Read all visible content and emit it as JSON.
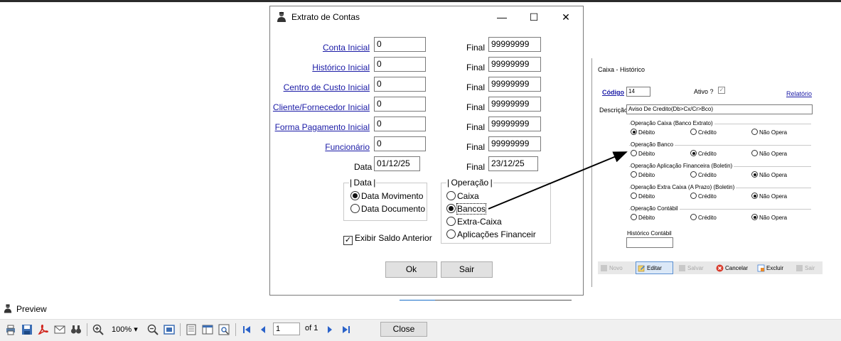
{
  "dialog": {
    "title": "Extrato de Contas",
    "minimize": "—",
    "maximize": "☐",
    "close": "✕",
    "rows": [
      {
        "label": "Conta Inicial",
        "value": "0",
        "final_label": "Final",
        "final_value": "99999999"
      },
      {
        "label": "Histórico Inicial",
        "value": "0",
        "final_label": "Final",
        "final_value": "99999999"
      },
      {
        "label": "Centro de Custo Inicial",
        "value": "0",
        "final_label": "Final",
        "final_value": "99999999"
      },
      {
        "label": "Cliente/Fornecedor Inicial",
        "value": "0",
        "final_label": "Final",
        "final_value": "99999999"
      },
      {
        "label": "Forma Pagamento Inicial",
        "value": "0",
        "final_label": "Final",
        "final_value": "99999999"
      },
      {
        "label": "Funcionário",
        "value": "0",
        "final_label": "Final",
        "final_value": "99999999"
      }
    ],
    "date_row": {
      "label": "Data",
      "value": "01/12/25",
      "final_label": "Final",
      "final_value": "23/12/25"
    },
    "data_group": {
      "title": "Data",
      "options": [
        "Data Movimento",
        "Data Documento"
      ],
      "selected": "Data Movimento"
    },
    "operacao_group": {
      "title": "Operação",
      "options": [
        "Caixa",
        "Bancos",
        "Extra-Caixa",
        "Aplicações Financeir"
      ],
      "selected": "Bancos"
    },
    "exibir_saldo": {
      "label": "Exibir Saldo Anterior",
      "checked": true
    },
    "ok_label": "Ok",
    "sair_label": "Sair"
  },
  "right_panel": {
    "title": "Caixa - Histórico",
    "codigo_label": "Código",
    "codigo_value": "14",
    "ativo_label": "Ativo ?",
    "ativo_checked": true,
    "relatorio_label": "Relatório",
    "descricao_label": "Descrição",
    "descricao_value": "Aviso De Credito(Db>Cx/Cr>Bco)",
    "groups": [
      {
        "title": "Operação Caixa (Banco Extrato)",
        "options": [
          "Débito",
          "Crédito",
          "Não Opera"
        ],
        "selected": "Débito"
      },
      {
        "title": "Operação Banco",
        "options": [
          "Débito",
          "Crédito",
          "Não Opera"
        ],
        "selected": "Crédito"
      },
      {
        "title": "Operação Aplicação Financeira (Boletin)",
        "options": [
          "Débito",
          "Crédito",
          "Não Opera"
        ],
        "selected": "Não Opera"
      },
      {
        "title": "Operação Extra Caixa (A Prazo) (Boletin)",
        "options": [
          "Débito",
          "Crédito",
          "Não Opera"
        ],
        "selected": "Não Opera"
      },
      {
        "title": "Operação Contábil",
        "options": [
          "Débito",
          "Crédito",
          "Não Opera"
        ],
        "selected": "Não Opera"
      }
    ],
    "historico_contabil_label": "Histórico Contábil",
    "historico_contabil_value": "",
    "toolbar": {
      "novo": "Novo",
      "editar": "Editar",
      "salvar": "Salvar",
      "cancelar": "Cancelar",
      "excluir": "Excluir",
      "sair": "Sair"
    }
  },
  "preview": {
    "title": "Preview",
    "zoom": "100%",
    "page": "1",
    "of_label": "of 1",
    "close_label": "Close"
  },
  "colors": {
    "link": "#1a1aa6",
    "arrow": "#000000",
    "pdf_red": "#d0241c",
    "nav_blue": "#2a62c9"
  }
}
